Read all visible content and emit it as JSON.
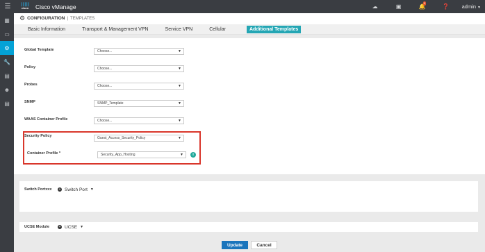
{
  "topbar": {
    "menu_icon": "hamburger-menu-icon",
    "logo_text": "cisco",
    "app_title": "Cisco vManage",
    "icons": [
      "cloud-icon",
      "task-icon",
      "bell-icon",
      "help-icon"
    ],
    "notification_count": "9",
    "user": "admin"
  },
  "sidebar": {
    "items": [
      {
        "icon": "dashboard-icon"
      },
      {
        "icon": "monitor-icon"
      },
      {
        "icon": "configuration-gear-icon",
        "active": true
      },
      {
        "icon": "tools-wrench-icon"
      },
      {
        "icon": "maintenance-toolbox-icon"
      },
      {
        "icon": "administration-users-icon"
      },
      {
        "icon": "analytics-icon"
      }
    ]
  },
  "header": {
    "section": "CONFIGURATION",
    "page": "TEMPLATES"
  },
  "tabs": [
    {
      "label": "Basic Information"
    },
    {
      "label": "Transport & Management VPN"
    },
    {
      "label": "Service VPN"
    },
    {
      "label": "Cellular"
    },
    {
      "label": "Additional Templates",
      "active": true
    }
  ],
  "fields": {
    "global_template": {
      "label": "Global Template",
      "value": "Choose..."
    },
    "policy": {
      "label": "Policy",
      "value": "Choose..."
    },
    "probes": {
      "label": "Probes",
      "value": "Choose..."
    },
    "snmp": {
      "label": "SNMP",
      "value": "SNMP_Template"
    },
    "waas": {
      "label": "WAAS Container Profile",
      "value": "Choose..."
    },
    "security_policy": {
      "label": "Security Policy",
      "value": "Guest_Access_Security_Policy"
    },
    "container_profile": {
      "label": "Container Profile *",
      "value": "Security_App_Hosting"
    }
  },
  "switch_port": {
    "label": "Switch Portxxx",
    "value": "Switch Port"
  },
  "ucse": {
    "label": "UCSE Module",
    "value": "UCSE"
  },
  "footer": {
    "update_label": "Update",
    "cancel_label": "Cancel"
  },
  "colors": {
    "topbar_bg": "#3a3d42",
    "active_nav": "#04a2d6",
    "active_tab": "#24a6b4",
    "highlight_border": "#d9362b",
    "info_icon": "#21a99b",
    "update_button": "#1b75bc"
  }
}
